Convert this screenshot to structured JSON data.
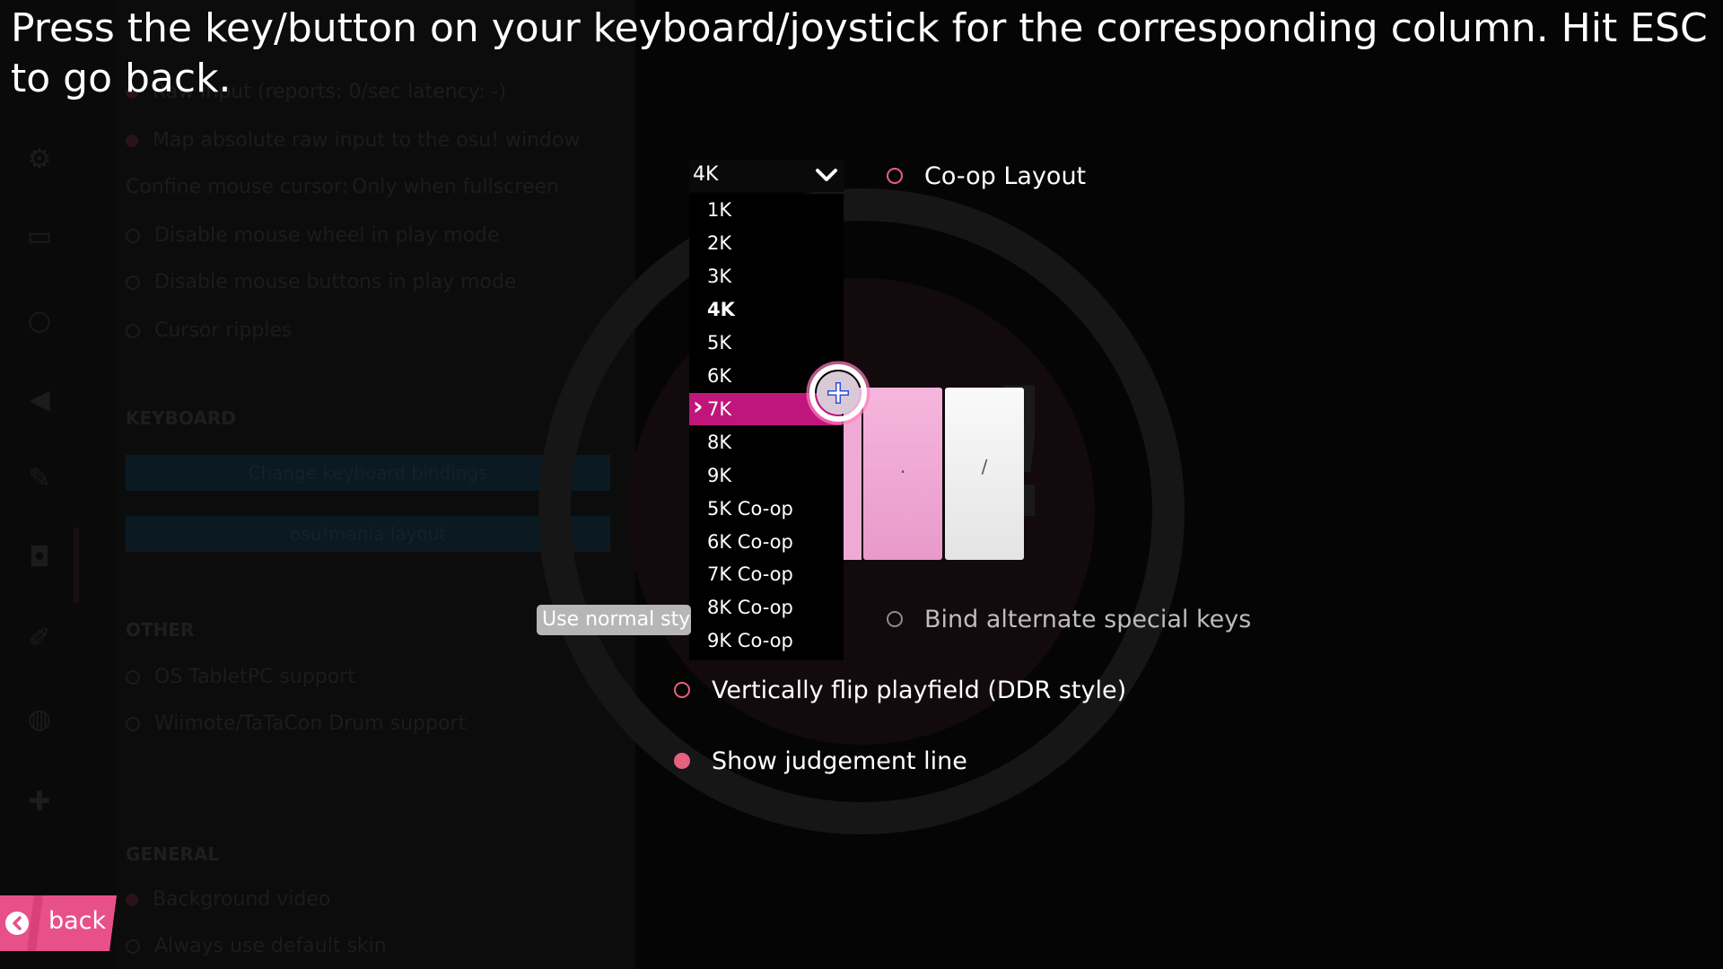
{
  "instructions": "Press the key/button on your keyboard/joystick for the corresponding column. Hit ESC to go back.",
  "layout_select": {
    "value": "4K"
  },
  "layout_options": [
    {
      "label": "1K"
    },
    {
      "label": "2K"
    },
    {
      "label": "3K"
    },
    {
      "label": "4K"
    },
    {
      "label": "5K"
    },
    {
      "label": "6K"
    },
    {
      "label": "7K"
    },
    {
      "label": "8K"
    },
    {
      "label": "9K"
    },
    {
      "label": "5K Co-op"
    },
    {
      "label": "6K Co-op"
    },
    {
      "label": "7K Co-op"
    },
    {
      "label": "8K Co-op"
    },
    {
      "label": "9K Co-op"
    }
  ],
  "options": {
    "coop_layout": {
      "label": "Co-op Layout",
      "checked": false
    },
    "bind_alternate": {
      "label": "Bind alternate special keys",
      "checked": false
    },
    "vertical_flip": {
      "label": "Vertically flip playfield (DDR style)",
      "checked": false
    },
    "judgement_line": {
      "label": "Show judgement line",
      "checked": true
    }
  },
  "style_select": {
    "value": "Use normal sty"
  },
  "columns": [
    {
      "key": "."
    },
    {
      "key": "/"
    }
  ],
  "back_button": {
    "label": "back"
  },
  "background_panel": {
    "items": [
      "Raw input (reports: 0/sec latency: -)",
      "Map absolute raw input to the osu! window",
      "Confine mouse cursor:",
      "Only when fullscreen",
      "Disable mouse wheel in play mode",
      "Disable mouse buttons in play mode",
      "Cursor ripples",
      "KEYBOARD",
      "Change keyboard bindings",
      "osu!mania layout",
      "OTHER",
      "OS TabletPC support",
      "Wiimote/TaTaCon Drum support",
      "GENERAL",
      "Background video",
      "Always use default skin"
    ]
  },
  "colors": {
    "accent": "#e8607f",
    "highlight": "#c0157a",
    "column_pink": "#f0a8d4",
    "column_white": "#f2f2f2",
    "back_button": "#e8508a"
  }
}
